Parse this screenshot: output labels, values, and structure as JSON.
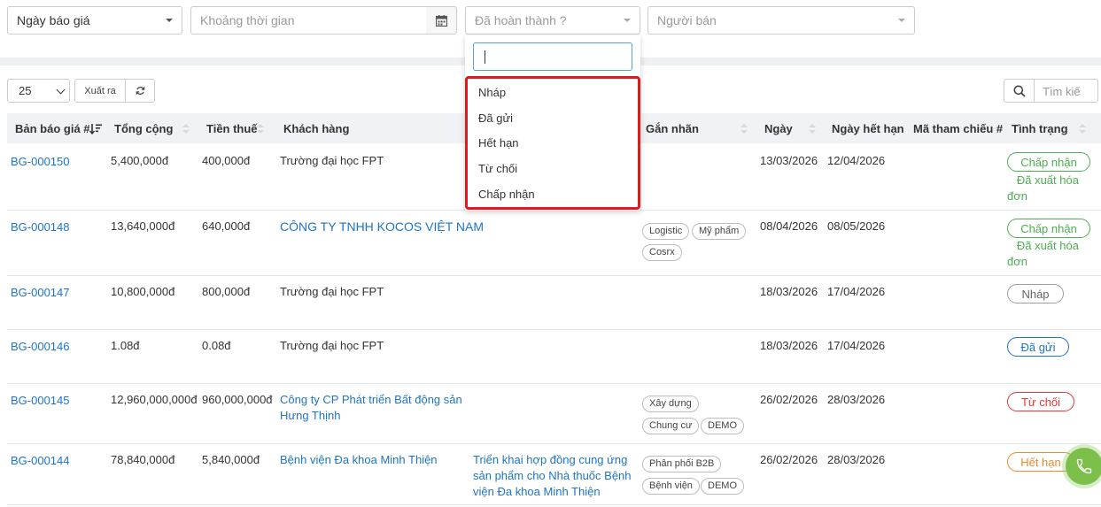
{
  "filters": {
    "date_type": "Ngày báo giá",
    "time_range_placeholder": "Khoảng thời gian",
    "status_placeholder": "Đã hoàn thành ?",
    "seller_placeholder": "Người bán"
  },
  "status_dropdown": {
    "options": [
      "Nháp",
      "Đã gửi",
      "Hết hạn",
      "Từ chối",
      "Chấp nhận"
    ]
  },
  "toolbar": {
    "page_size": "25",
    "export_label": "Xuất ra",
    "search_placeholder": "Tìm kiế"
  },
  "table": {
    "columns": [
      "Bản báo giá #",
      "Tổng cộng",
      "Tiền thuế",
      "Khách hàng",
      "Gắn nhãn",
      "Ngày",
      "Ngày hết hạn",
      "Mã tham chiếu #",
      "Tình trạng"
    ],
    "rows": [
      {
        "id": "BG-000150",
        "total": "5,400,000đ",
        "tax": "400,000đ",
        "customer": "Trường đại học FPT",
        "project": "",
        "tags": [],
        "date": "13/03/2026",
        "expiry": "12/04/2026",
        "status": "Chấp nhận",
        "note": "Đã xuất hóa đơn"
      },
      {
        "id": "BG-000148",
        "total": "13,640,000đ",
        "tax": "640,000đ",
        "customer": "CÔNG TY TNHH KOCOS VIỆT NAM",
        "project": "",
        "tags": [
          "Logistic",
          "Mỹ phẩm",
          "Cosrx"
        ],
        "date": "08/04/2026",
        "expiry": "08/05/2026",
        "status": "Chấp nhận",
        "note": "Đã xuất hóa đơn"
      },
      {
        "id": "BG-000147",
        "total": "10,800,000đ",
        "tax": "800,000đ",
        "customer": "Trường đại học FPT",
        "project": "",
        "tags": [],
        "date": "18/03/2026",
        "expiry": "17/04/2026",
        "status": "Nháp",
        "note": ""
      },
      {
        "id": "BG-000146",
        "total": "1.08đ",
        "tax": "0.08đ",
        "customer": "Trường đại học FPT",
        "project": "",
        "tags": [],
        "date": "18/03/2026",
        "expiry": "17/04/2026",
        "status": "Đã gửi",
        "note": ""
      },
      {
        "id": "BG-000145",
        "total": "12,960,000,000đ",
        "tax": "960,000,000đ",
        "customer": "Công ty CP Phát triển Bất động sản Hưng Thịnh",
        "project": "",
        "tags": [
          "Xây dựng",
          "Chung cư",
          "DEMO"
        ],
        "date": "26/02/2026",
        "expiry": "28/03/2026",
        "status": "Từ chối",
        "note": ""
      },
      {
        "id": "BG-000144",
        "total": "78,840,000đ",
        "tax": "5,840,000đ",
        "customer": "Bệnh viện Đa khoa Minh Thiện",
        "project": "Triển khai hợp đồng cung ứng sản phẩm cho Nhà thuốc Bệnh viện Đa khoa Minh Thiện",
        "tags": [
          "Phân phối B2B",
          "Bệnh viện",
          "DEMO"
        ],
        "date": "26/02/2026",
        "expiry": "28/03/2026",
        "status": "Hết hạn",
        "note": ""
      }
    ]
  },
  "colors": {
    "link": "#1e74c6",
    "accepted": "#4caf50",
    "sent": "#1e74c6",
    "draft": "#9e9e9e",
    "rejected": "#e53935",
    "expired": "#ef8a2c",
    "highlight": "#e01b1b",
    "phone": "#7cc04b"
  },
  "icons": {
    "calendar": "calendar-icon",
    "refresh": "refresh-icon",
    "search": "search-icon",
    "phone": "phone-icon",
    "sort": "sort-desc-icon"
  }
}
